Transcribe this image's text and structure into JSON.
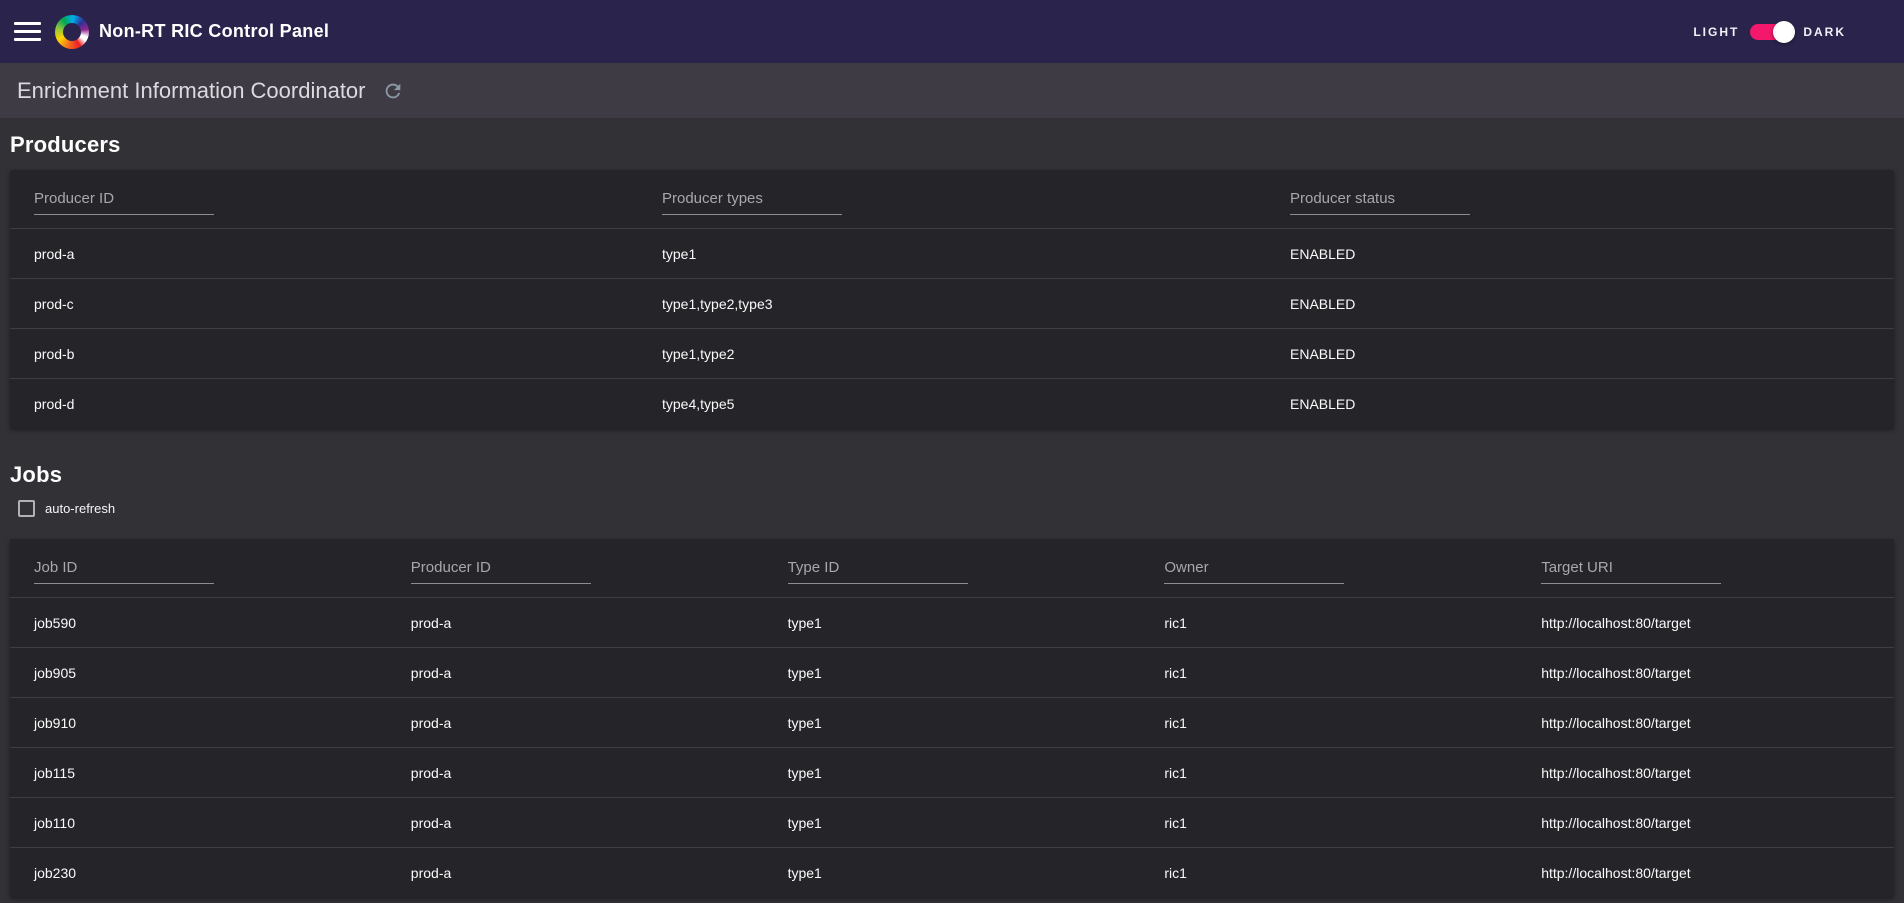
{
  "header": {
    "app_title": "Non-RT RIC Control Panel",
    "background_color": "#2a244d",
    "theme_toggle": {
      "light_label": "LIGHT",
      "dark_label": "DARK",
      "state": "dark",
      "accent_color": "#f3186c"
    }
  },
  "page": {
    "title": "Enrichment Information Coordinator",
    "refresh_icon": "refresh-icon"
  },
  "producers": {
    "heading": "Producers",
    "filters": {
      "producer_id": "Producer ID",
      "producer_types": "Producer types",
      "producer_status": "Producer status"
    },
    "rows": [
      {
        "producer_id": "prod-a",
        "producer_types": "type1",
        "producer_status": "ENABLED"
      },
      {
        "producer_id": "prod-c",
        "producer_types": "type1,type2,type3",
        "producer_status": "ENABLED"
      },
      {
        "producer_id": "prod-b",
        "producer_types": "type1,type2",
        "producer_status": "ENABLED"
      },
      {
        "producer_id": "prod-d",
        "producer_types": "type4,type5",
        "producer_status": "ENABLED"
      }
    ]
  },
  "jobs": {
    "heading": "Jobs",
    "auto_refresh": {
      "label": "auto-refresh",
      "checked": false
    },
    "filters": {
      "job_id": "Job ID",
      "producer_id": "Producer ID",
      "type_id": "Type ID",
      "owner": "Owner",
      "target_uri": "Target URI"
    },
    "rows": [
      {
        "job_id": "job590",
        "producer_id": "prod-a",
        "type_id": "type1",
        "owner": "ric1",
        "target_uri": "http://localhost:80/target"
      },
      {
        "job_id": "job905",
        "producer_id": "prod-a",
        "type_id": "type1",
        "owner": "ric1",
        "target_uri": "http://localhost:80/target"
      },
      {
        "job_id": "job910",
        "producer_id": "prod-a",
        "type_id": "type1",
        "owner": "ric1",
        "target_uri": "http://localhost:80/target"
      },
      {
        "job_id": "job115",
        "producer_id": "prod-a",
        "type_id": "type1",
        "owner": "ric1",
        "target_uri": "http://localhost:80/target"
      },
      {
        "job_id": "job110",
        "producer_id": "prod-a",
        "type_id": "type1",
        "owner": "ric1",
        "target_uri": "http://localhost:80/target"
      },
      {
        "job_id": "job230",
        "producer_id": "prod-a",
        "type_id": "type1",
        "owner": "ric1",
        "target_uri": "http://localhost:80/target"
      }
    ]
  }
}
